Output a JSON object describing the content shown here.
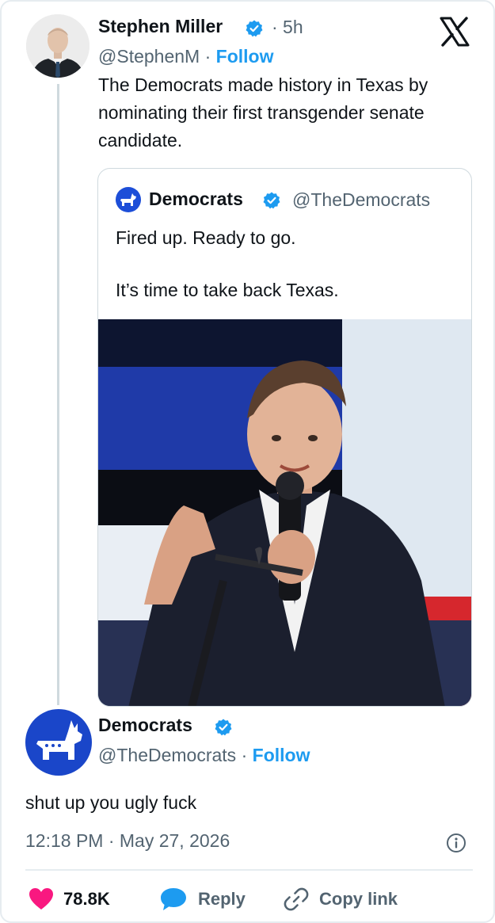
{
  "tweet": {
    "author_name": "Stephen Miller",
    "time_ago": "· 5h",
    "handle": "@StephenM",
    "separator": "·",
    "follow_label": "Follow",
    "text": "The Democrats made history in Texas by nominating their first transgender senate candidate."
  },
  "quoted": {
    "author_name": "Democrats",
    "handle": "@TheDemocrats",
    "line1": "Fired up. Ready to go.",
    "line2": "It’s time to take back Texas."
  },
  "reply": {
    "author_name": "Democrats",
    "handle": "@TheDemocrats",
    "separator": "·",
    "follow_label": "Follow",
    "text": "shut up you ugly fuck",
    "timestamp": "12:18 PM · May 27, 2026"
  },
  "actions": {
    "likes_count": "78.8K",
    "reply_label": "Reply",
    "copy_link_label": "Copy link"
  },
  "colors": {
    "accent": "#1d9bf0",
    "like": "#f91880",
    "secondary_text": "#536471"
  },
  "icons": {
    "platform": "x-logo-icon",
    "verified": "verified-badge-icon",
    "info": "info-icon",
    "like": "heart-icon",
    "reply": "speech-bubble-icon",
    "copy": "link-icon"
  }
}
